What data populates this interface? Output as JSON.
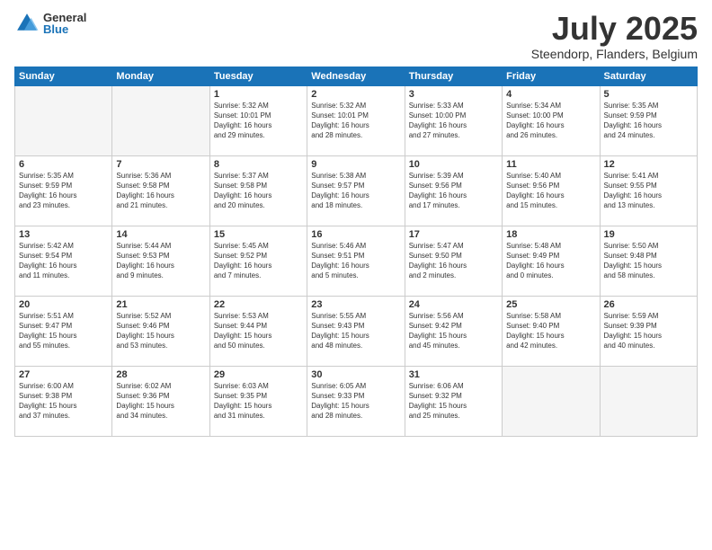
{
  "header": {
    "logo_general": "General",
    "logo_blue": "Blue",
    "title": "July 2025",
    "subtitle": "Steendorp, Flanders, Belgium"
  },
  "days_of_week": [
    "Sunday",
    "Monday",
    "Tuesday",
    "Wednesday",
    "Thursday",
    "Friday",
    "Saturday"
  ],
  "weeks": [
    [
      {
        "day": "",
        "info": ""
      },
      {
        "day": "",
        "info": ""
      },
      {
        "day": "1",
        "info": "Sunrise: 5:32 AM\nSunset: 10:01 PM\nDaylight: 16 hours\nand 29 minutes."
      },
      {
        "day": "2",
        "info": "Sunrise: 5:32 AM\nSunset: 10:01 PM\nDaylight: 16 hours\nand 28 minutes."
      },
      {
        "day": "3",
        "info": "Sunrise: 5:33 AM\nSunset: 10:00 PM\nDaylight: 16 hours\nand 27 minutes."
      },
      {
        "day": "4",
        "info": "Sunrise: 5:34 AM\nSunset: 10:00 PM\nDaylight: 16 hours\nand 26 minutes."
      },
      {
        "day": "5",
        "info": "Sunrise: 5:35 AM\nSunset: 9:59 PM\nDaylight: 16 hours\nand 24 minutes."
      }
    ],
    [
      {
        "day": "6",
        "info": "Sunrise: 5:35 AM\nSunset: 9:59 PM\nDaylight: 16 hours\nand 23 minutes."
      },
      {
        "day": "7",
        "info": "Sunrise: 5:36 AM\nSunset: 9:58 PM\nDaylight: 16 hours\nand 21 minutes."
      },
      {
        "day": "8",
        "info": "Sunrise: 5:37 AM\nSunset: 9:58 PM\nDaylight: 16 hours\nand 20 minutes."
      },
      {
        "day": "9",
        "info": "Sunrise: 5:38 AM\nSunset: 9:57 PM\nDaylight: 16 hours\nand 18 minutes."
      },
      {
        "day": "10",
        "info": "Sunrise: 5:39 AM\nSunset: 9:56 PM\nDaylight: 16 hours\nand 17 minutes."
      },
      {
        "day": "11",
        "info": "Sunrise: 5:40 AM\nSunset: 9:56 PM\nDaylight: 16 hours\nand 15 minutes."
      },
      {
        "day": "12",
        "info": "Sunrise: 5:41 AM\nSunset: 9:55 PM\nDaylight: 16 hours\nand 13 minutes."
      }
    ],
    [
      {
        "day": "13",
        "info": "Sunrise: 5:42 AM\nSunset: 9:54 PM\nDaylight: 16 hours\nand 11 minutes."
      },
      {
        "day": "14",
        "info": "Sunrise: 5:44 AM\nSunset: 9:53 PM\nDaylight: 16 hours\nand 9 minutes."
      },
      {
        "day": "15",
        "info": "Sunrise: 5:45 AM\nSunset: 9:52 PM\nDaylight: 16 hours\nand 7 minutes."
      },
      {
        "day": "16",
        "info": "Sunrise: 5:46 AM\nSunset: 9:51 PM\nDaylight: 16 hours\nand 5 minutes."
      },
      {
        "day": "17",
        "info": "Sunrise: 5:47 AM\nSunset: 9:50 PM\nDaylight: 16 hours\nand 2 minutes."
      },
      {
        "day": "18",
        "info": "Sunrise: 5:48 AM\nSunset: 9:49 PM\nDaylight: 16 hours\nand 0 minutes."
      },
      {
        "day": "19",
        "info": "Sunrise: 5:50 AM\nSunset: 9:48 PM\nDaylight: 15 hours\nand 58 minutes."
      }
    ],
    [
      {
        "day": "20",
        "info": "Sunrise: 5:51 AM\nSunset: 9:47 PM\nDaylight: 15 hours\nand 55 minutes."
      },
      {
        "day": "21",
        "info": "Sunrise: 5:52 AM\nSunset: 9:46 PM\nDaylight: 15 hours\nand 53 minutes."
      },
      {
        "day": "22",
        "info": "Sunrise: 5:53 AM\nSunset: 9:44 PM\nDaylight: 15 hours\nand 50 minutes."
      },
      {
        "day": "23",
        "info": "Sunrise: 5:55 AM\nSunset: 9:43 PM\nDaylight: 15 hours\nand 48 minutes."
      },
      {
        "day": "24",
        "info": "Sunrise: 5:56 AM\nSunset: 9:42 PM\nDaylight: 15 hours\nand 45 minutes."
      },
      {
        "day": "25",
        "info": "Sunrise: 5:58 AM\nSunset: 9:40 PM\nDaylight: 15 hours\nand 42 minutes."
      },
      {
        "day": "26",
        "info": "Sunrise: 5:59 AM\nSunset: 9:39 PM\nDaylight: 15 hours\nand 40 minutes."
      }
    ],
    [
      {
        "day": "27",
        "info": "Sunrise: 6:00 AM\nSunset: 9:38 PM\nDaylight: 15 hours\nand 37 minutes."
      },
      {
        "day": "28",
        "info": "Sunrise: 6:02 AM\nSunset: 9:36 PM\nDaylight: 15 hours\nand 34 minutes."
      },
      {
        "day": "29",
        "info": "Sunrise: 6:03 AM\nSunset: 9:35 PM\nDaylight: 15 hours\nand 31 minutes."
      },
      {
        "day": "30",
        "info": "Sunrise: 6:05 AM\nSunset: 9:33 PM\nDaylight: 15 hours\nand 28 minutes."
      },
      {
        "day": "31",
        "info": "Sunrise: 6:06 AM\nSunset: 9:32 PM\nDaylight: 15 hours\nand 25 minutes."
      },
      {
        "day": "",
        "info": ""
      },
      {
        "day": "",
        "info": ""
      }
    ]
  ]
}
